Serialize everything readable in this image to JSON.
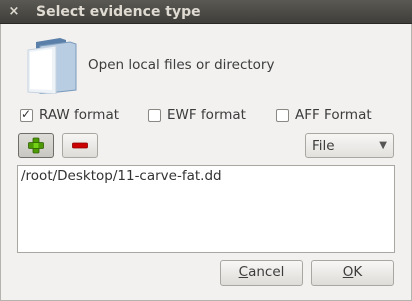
{
  "window": {
    "title": "Select evidence type",
    "close_glyph": "×"
  },
  "open": {
    "icon": "folder-icon",
    "label": "Open local files or directory"
  },
  "formats": [
    {
      "label": "RAW format",
      "checked": true
    },
    {
      "label": "EWF format",
      "checked": false
    },
    {
      "label": "AFF Format",
      "checked": false
    }
  ],
  "toolbar": {
    "add_icon": "plus-icon",
    "remove_icon": "minus-icon",
    "add_color": "#4e9a06",
    "remove_color": "#cc0000"
  },
  "source_type": {
    "selected": "File",
    "arrow": "▼"
  },
  "evidence_list": {
    "items": [
      "/root/Desktop/11-carve-fat.dd"
    ]
  },
  "buttons": {
    "cancel_first": "C",
    "cancel_rest": "ancel",
    "ok_first": "O",
    "ok_rest": "K"
  }
}
